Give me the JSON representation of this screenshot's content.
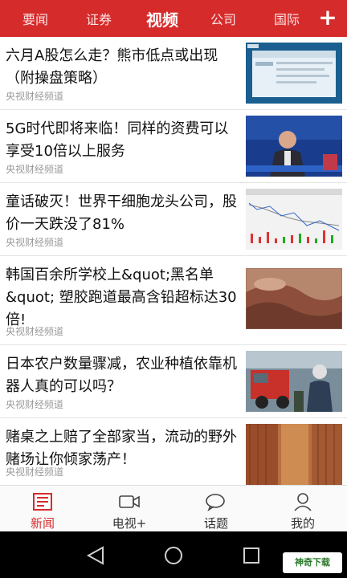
{
  "top_tabs": [
    "要闻",
    "证券",
    "视频",
    "公司",
    "国际"
  ],
  "add_icon": "plus-icon",
  "colors": {
    "brand": "#d62b2b",
    "active_tab": "#d62b2b",
    "text": "#111111",
    "source": "#9a9a9a"
  },
  "articles": [
    {
      "title": "六月A股怎么走？熊市低点或出现（附操盘策略）",
      "source": "央视财经频道"
    },
    {
      "title": "5G时代即将来临！同样的资费可以享受10倍以上服务",
      "source": "央视财经频道"
    },
    {
      "title": "童话破灭！世界干细胞龙头公司，股价一天跌没了81%",
      "source": "央视财经频道"
    },
    {
      "title": "韩国百余所学校上&quot;黑名单&quot; 塑胶跑道最高含铅超标达30倍!",
      "source": "央视财经频道"
    },
    {
      "title": "日本农户数量骤减，农业种植依靠机器人真的可以吗？",
      "source": "央视财经频道"
    },
    {
      "title": "赌桌之上赔了全部家当，流动的野外赌场让你倾家荡产！",
      "source": "央视财经频道"
    }
  ],
  "bottom_nav": [
    {
      "label": "新闻",
      "icon": "newspaper-icon"
    },
    {
      "label": "电视+",
      "icon": "video-camera-icon"
    },
    {
      "label": "话题",
      "icon": "chat-bubbles-icon"
    },
    {
      "label": "我的",
      "icon": "person-icon"
    }
  ],
  "system_nav": [
    "back-icon",
    "home-icon",
    "recents-icon"
  ],
  "watermark": "神奇下载"
}
